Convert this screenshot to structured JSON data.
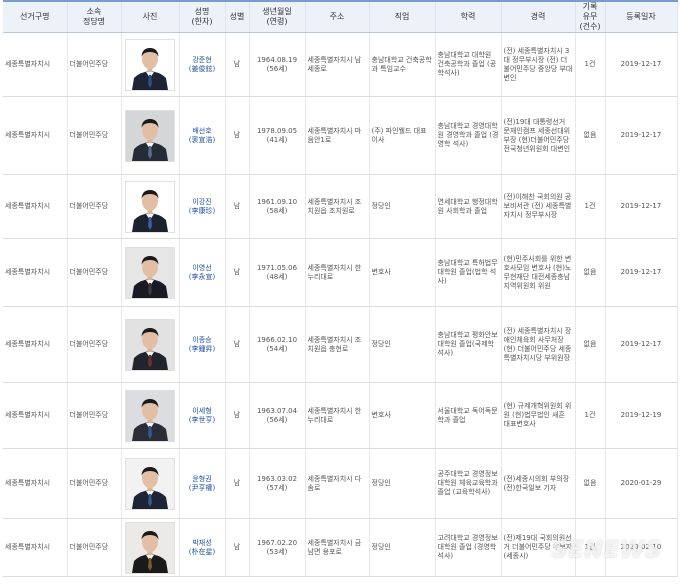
{
  "headers": {
    "district": "선거구명",
    "party": "소속\n정당명",
    "photo": "사진",
    "name": "성명\n(한자)",
    "gender": "성별",
    "birth": "생년월일\n(연령)",
    "address": "주소",
    "job": "직업",
    "education": "학력",
    "career": "경력",
    "criminal": "기록\n유무\n(건수)",
    "reg_date": "등록일자"
  },
  "rows": [
    {
      "district": "세종특별자치시",
      "party": "더불어민주당",
      "name": "강준현",
      "hanja": "(姜俊鉉)",
      "gender": "남",
      "birth": "1964.08.19",
      "age": "(56세)",
      "address": "세종특별자치시 남세종로",
      "job": "충남대학교 건축공학과 특임교수",
      "education": "충남대학교 대학원 건축공학과 졸업 (공학석사)",
      "career": "(전) 세종특별자치시 3대 정무부시장 (전) 더불어민주당 중앙당 부대변인",
      "criminal": "1건",
      "reg_date": "2019-12-17",
      "photo": {
        "bg": "#ffffff",
        "suit": "#1e2433",
        "tie": "#2c4f8c"
      }
    },
    {
      "district": "세종특별자치시",
      "party": "더불어민주당",
      "name": "배선호",
      "hanja": "(裵宣浩)",
      "gender": "남",
      "birth": "1978.09.05",
      "age": "(41세)",
      "address": "세종특별자치시 마음안1로",
      "job": "(주) 파인웰드 대표이사",
      "education": "충남대학교 경영대학원 경영학과 졸업 (경영학 석사)",
      "career": "(전)19대 대통령선거 문재인캠프 세종선대위부장 (현)더불어민주당 전국청년위원회 대변인",
      "criminal": "없음",
      "reg_date": "2019-12-17",
      "photo": {
        "bg": "#d4d6d8",
        "suit": "#262b38",
        "tie": "#5a6f8f"
      }
    },
    {
      "district": "세종특별자치시",
      "party": "더불어민주당",
      "name": "이강진",
      "hanja": "(李康珍)",
      "gender": "남",
      "birth": "1961.09.10",
      "age": "(58세)",
      "address": "세종특별자치시 조치원읍 조치원로",
      "job": "정당인",
      "education": "연세대학교 행정대학원 사회학과 졸업",
      "career": "(전)이해찬 국회의원 공보비서관 (전) 세종특별자치시 정무부시장",
      "criminal": "1건",
      "reg_date": "2019-12-17",
      "photo": {
        "bg": "#ffffff",
        "suit": "#1b2230",
        "tie": "#3d5fa3"
      }
    },
    {
      "district": "세종특별자치시",
      "party": "더불어민주당",
      "name": "이영선",
      "hanja": "(李永宣)",
      "gender": "남",
      "birth": "1971.05.06",
      "age": "(48세)",
      "address": "세종특별자치시 한누리대로",
      "job": "변호사",
      "education": "충남대학교 특허법무대학원 졸업(법학 석사)",
      "career": "(현)민주사회를 위한 변호사모임 변호사 (현)노무현재단 대전세종충남지역위원회 위원",
      "criminal": "없음",
      "reg_date": "2019-12-17",
      "photo": {
        "bg": "#e6e6e6",
        "suit": "#1a1a24",
        "tie": "#3a3a3a"
      }
    },
    {
      "district": "세종특별자치시",
      "party": "더불어민주당",
      "name": "이종승",
      "hanja": "(李鍾昇)",
      "gender": "남",
      "birth": "1966.02.10",
      "age": "(54세)",
      "address": "세종특별자치시 조치원읍 충현로",
      "job": "정당인",
      "education": "충남대학교 평화안보대학원 졸업(국제학석사)",
      "career": "(전) 세종특별자치시 장애인체육회 사무처장 (현) 더불어민주당 세종특별자치시당 부위원장",
      "criminal": "없음",
      "reg_date": "2019-12-17",
      "photo": {
        "bg": "#e2e2e2",
        "suit": "#21242c",
        "tie": "#6b3030"
      }
    },
    {
      "district": "세종특별자치시",
      "party": "더불어민주당",
      "name": "이세형",
      "hanja": "(李世亨)",
      "gender": "남",
      "birth": "1963.07.04",
      "age": "(56세)",
      "address": "세종특별자치시 한누리대로",
      "job": "변호사",
      "education": "서울대학교 독어독문학과 졸업",
      "career": "(현) 규제개혁위원회 위원 (현)법무법인 새흔 대표변호사",
      "criminal": "1건",
      "reg_date": "2019-12-19",
      "photo": {
        "bg": "#dcdde0",
        "suit": "#2a2d36",
        "tie": "#2f5a9a"
      }
    },
    {
      "district": "세종특별자치시",
      "party": "더불어민주당",
      "name": "윤형권",
      "hanja": "(尹亨權)",
      "gender": "남",
      "birth": "1963.03.02",
      "age": "(57세)",
      "address": "세종특별자치시 다솜로",
      "job": "정당인",
      "education": "공주대학교 경영정보대학원 체육교육학과 졸업 (교육학석사)",
      "career": "(전)세종시의회 부의장 (전)한국일보 기자",
      "criminal": "없음",
      "reg_date": "2020-01-29",
      "photo": {
        "bg": "#f2f2f2",
        "suit": "#1c2435",
        "tie": "#3c568a"
      }
    },
    {
      "district": "세종특별자치시",
      "party": "더불어민주당",
      "name": "박재성",
      "hanja": "(朴在星)",
      "gender": "남",
      "birth": "1967.02.20",
      "age": "(53세)",
      "address": "세종특별자치시 금남면 용포로",
      "job": "정당인",
      "education": "고려대학교 경영정보대학원 졸업 (경영학석사)",
      "career": "(전)제19대 국회의원선거 더불어민주당 후보자 (세종시)",
      "criminal": "1건",
      "reg_date": "2020-02-10",
      "photo": {
        "bg": "#eceae6",
        "suit": "#1a1a1a",
        "tie": "#7a5a2a"
      }
    }
  ],
  "watermark": "SENEWS"
}
